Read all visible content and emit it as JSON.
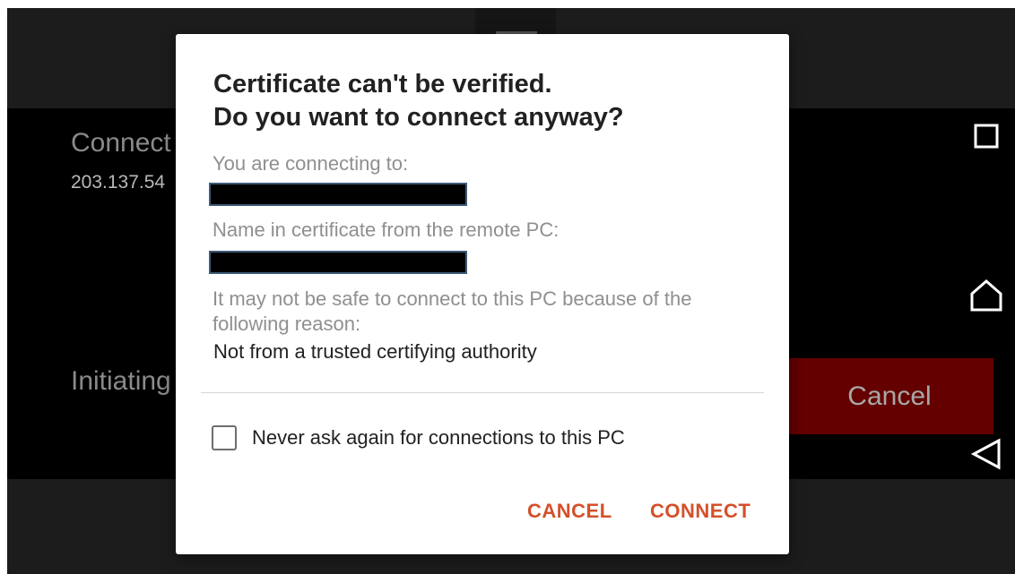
{
  "background": {
    "connecting_label": "Connect",
    "ip_partial": "203.137.54",
    "initiating_label": "Initiating",
    "cancel_button_label": "Cancel"
  },
  "dialog": {
    "title_line1": "Certificate can't be verified.",
    "title_line2": "Do you want to connect anyway?",
    "connecting_to_label": "You are connecting to:",
    "cert_name_label": "Name in certificate from the remote PC:",
    "reason_intro": "It may not be safe to connect to this PC because of the following reason:",
    "reason_value": "Not from a trusted certifying authority",
    "never_ask_label": "Never ask again for connections to this PC",
    "never_ask_checked": false,
    "cancel_label": "CANCEL",
    "connect_label": "CONNECT"
  },
  "navigation": {
    "icons": [
      "recents-square-icon",
      "home-icon",
      "back-icon"
    ]
  },
  "colors": {
    "accent": "#d4502a",
    "background_cancel": "#640000",
    "dialog_bg": "#ffffff",
    "screen_bg": "#000000"
  }
}
